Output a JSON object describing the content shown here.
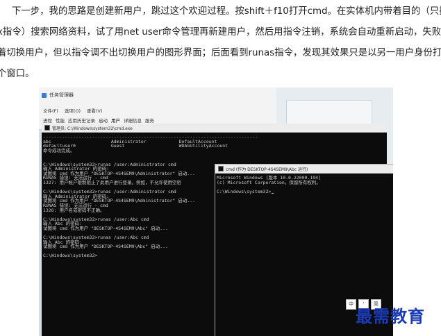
{
  "article": {
    "lines": [
      "下一步，我的思路是创建新用户，跳过这个欢迎过程。按shift＋f10打开cmd。在实体机内带着目的（只搜具",
      "x指令）搜索网络资料，试了用net user命令管理再新建用户，然后用指令注销，系统会自动重新启动，失败；试",
      "着切换用户，但以指令调不出切换用户的图形界面；后面看到runas指令，发现其效果只是以另一用户身份打开一",
      "个窗口。"
    ]
  },
  "screenshot": {
    "task_manager": {
      "title": "任务管理器",
      "menu": [
        "文件(F)",
        "选项(O)",
        "查看(V)"
      ],
      "tabs": [
        "进程",
        "性能",
        "应用历史记录",
        "启动",
        "用户",
        "详细信息",
        "服务"
      ],
      "active_tab": "用户"
    },
    "cmd_main": {
      "title": "管理员: C:\\Windows\\system32\\cmd.exe",
      "lines": [
        "-------------------------------------------------------------------------------",
        "abc                      Administrator            DefaultAccount",
        "defaultuser0             Guest                    WDAGUtilityAccount",
        "命令成功完成。",
        "",
        "",
        "C:\\Windows\\system32>runas /user:Administrator cmd",
        "输入 Administrator 的密码:",
        "试图将 cmd 作为用户 \"DESKTOP-4S4SEM9\\Administrator\" 启动...",
        "RUNAS 错误: 无法运行 - cmd",
        "1327: 用户帐户限制阻止了此用户进行登录。例如，不允许使用空密",
        "",
        "C:\\Windows\\system32>runas /user:Administrator cmd",
        "输入 Administrator 的密码:",
        "试图将 cmd 作为用户 \"DESKTOP-4S4SEM9\\Administrator\" 启动...",
        "RUNAS 错误: 无法运行 - cmd",
        "1326: 用户名或密码不正确。",
        "",
        "C:\\Windows\\system32>runas /user:Abc cmd",
        "输入 Abc 的密码:",
        "试图将 cmd 作为用户 \"DESKTOP-4S4SEM9\\Abc\" 启动...",
        "",
        "C:\\Windows\\system32>runas /user:Abc cmd",
        "输入 Abc 的密码:",
        "试图将 cmd 作为用户 \"DESKTOP-4S4SEM9\\Abc\" 启动...",
        "",
        "C:\\Windows\\system32>"
      ]
    },
    "cmd_abc": {
      "title": "cmd (作为 DESKTOP-4S4SEM9\\Abc 运行)",
      "lines": [
        "Microsoft Windows [版本 10.0.22000.194]",
        "(c) Microsoft Corporation。保留所有权利。",
        "",
        "C:\\Windows\\system32>"
      ]
    },
    "ime_buttons": [
      "中",
      "'",
      "简"
    ]
  },
  "watermark": "最需教育"
}
